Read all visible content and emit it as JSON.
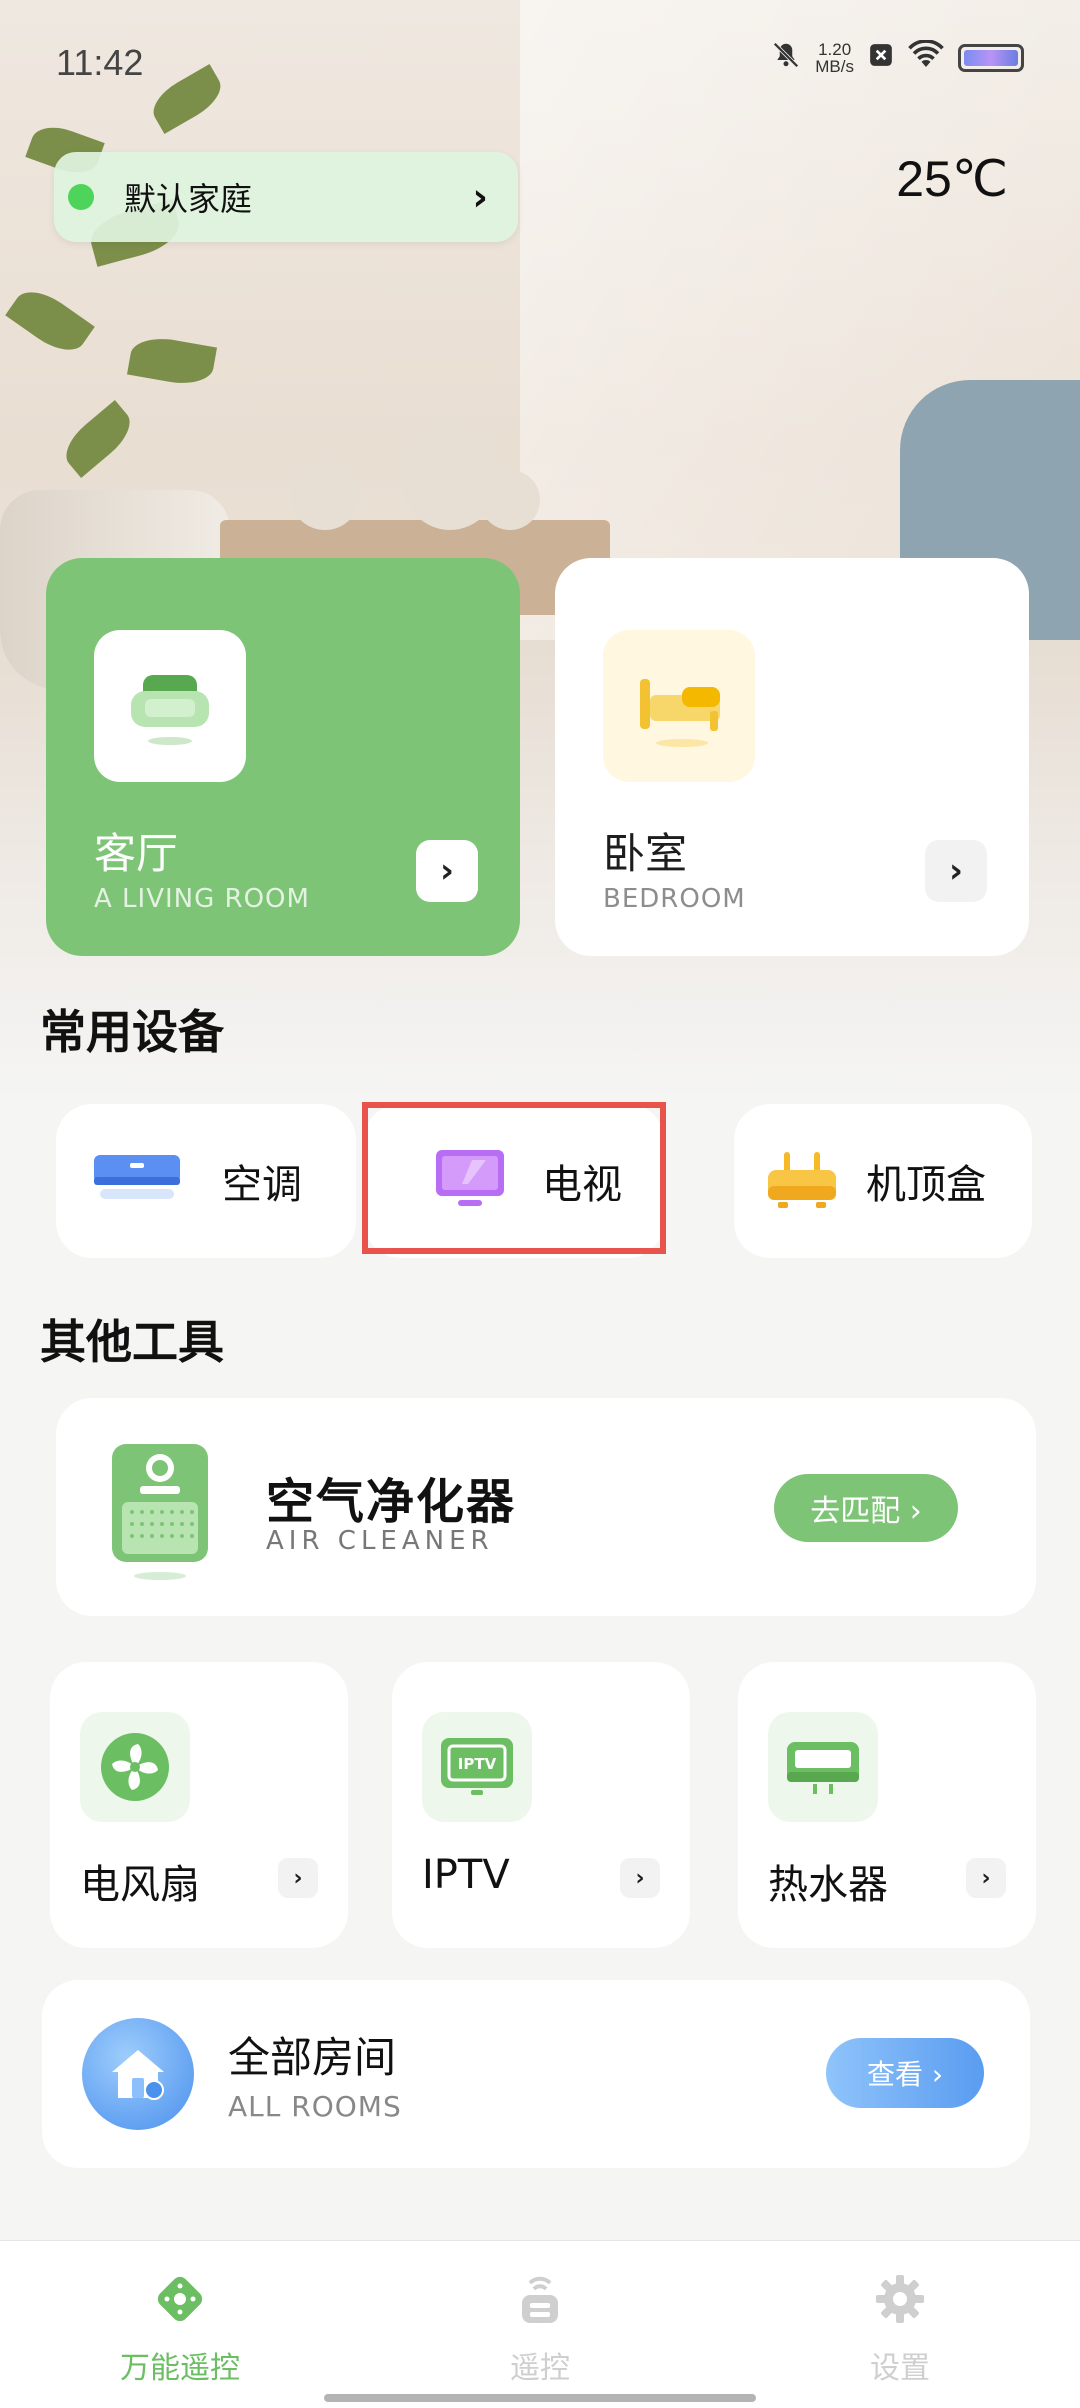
{
  "status_bar": {
    "time": "11:42",
    "net_speed_value": "1.20",
    "net_speed_unit": "MB/s",
    "icons": [
      "mute-icon",
      "close-box-icon",
      "wifi-icon",
      "battery-icon"
    ]
  },
  "header": {
    "home_name": "默认家庭",
    "temperature": "25℃"
  },
  "rooms": [
    {
      "name": "客厅",
      "subtitle": "A LIVING ROOM",
      "icon": "sofa-icon",
      "active": true
    },
    {
      "name": "卧室",
      "subtitle": "BEDROOM",
      "icon": "bed-icon",
      "active": false
    }
  ],
  "common_devices": {
    "title": "常用设备",
    "items": [
      {
        "label": "空调",
        "icon": "air-conditioner-icon"
      },
      {
        "label": "电视",
        "icon": "tv-icon"
      },
      {
        "label": "机顶盒",
        "icon": "set-top-box-icon"
      }
    ]
  },
  "other_tools": {
    "title": "其他工具",
    "air_cleaner": {
      "title": "空气净化器",
      "subtitle": "AIR CLEANER",
      "button": "去匹配 ›"
    },
    "items": [
      {
        "label": "电风扇",
        "icon": "fan-icon"
      },
      {
        "label": "IPTV",
        "icon": "iptv-icon",
        "icon_text": "IPTV"
      },
      {
        "label": "热水器",
        "icon": "water-heater-icon"
      }
    ]
  },
  "all_rooms": {
    "title": "全部房间",
    "subtitle": "ALL ROOMS",
    "button": "查看 ›"
  },
  "bottom_nav": {
    "items": [
      {
        "label": "万能遥控",
        "icon": "universal-remote-icon",
        "active": true
      },
      {
        "label": "遥控",
        "icon": "remote-icon",
        "active": false
      },
      {
        "label": "设置",
        "icon": "gear-icon",
        "active": false
      }
    ]
  },
  "colors": {
    "accent_green": "#7ec477",
    "highlight_red": "#e8534c",
    "blue_button": "#5a9cf0"
  }
}
